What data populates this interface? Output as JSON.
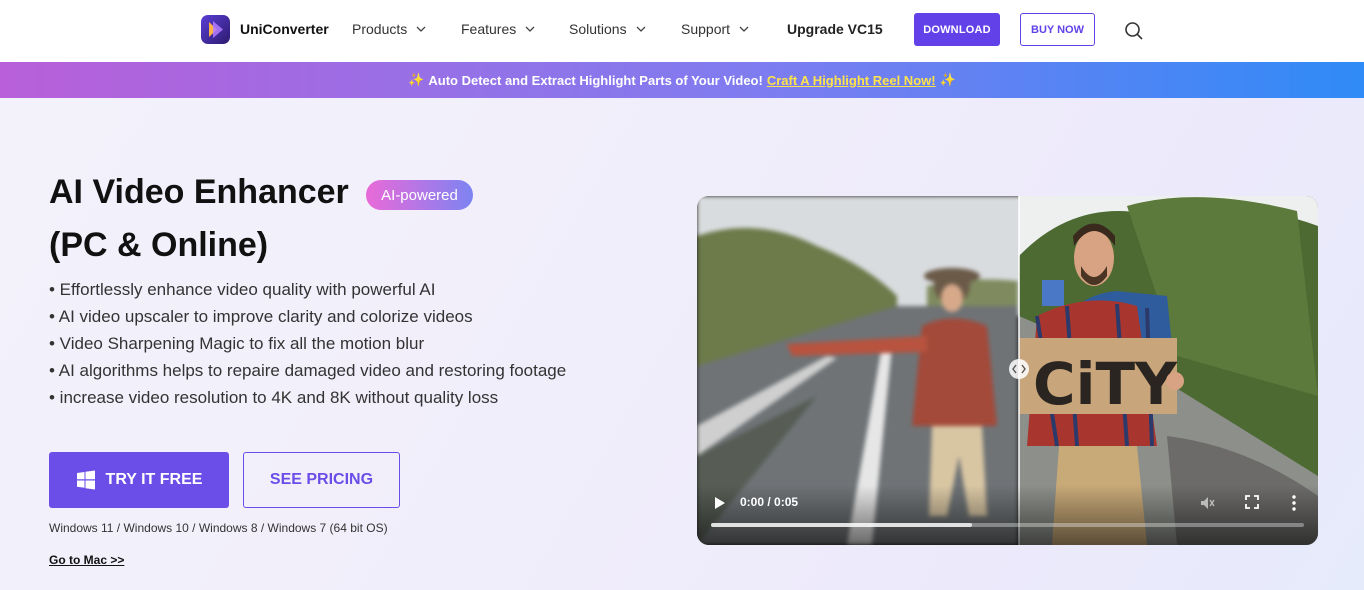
{
  "nav": {
    "brand": "UniConverter",
    "items": [
      {
        "label": "Products"
      },
      {
        "label": "Features"
      },
      {
        "label": "Solutions"
      },
      {
        "label": "Support"
      }
    ],
    "upgrade": "Upgrade VC15",
    "download": "DOWNLOAD",
    "buy": "BUY NOW",
    "search_icon": "search-icon"
  },
  "banner": {
    "text": "Auto Detect and Extract Highlight Parts of Your Video!",
    "link": "Craft A Highlight Reel Now!",
    "accent": "#ffe34a"
  },
  "hero": {
    "title_line1": "AI Video Enhancer",
    "badge": "AI-powered",
    "title_line2": "(PC & Online)",
    "features": [
      "• Effortlessly enhance video quality with powerful AI",
      "• AI video upscaler to improve clarity and colorize videos",
      "• Video Sharpening Magic to fix all the motion blur",
      "• AI algorithms helps to repaire damaged video and restoring footage",
      "• increase video resolution to 4K and 8K without quality loss"
    ],
    "try_free": "TRY IT FREE",
    "see_pricing": "SEE PRICING",
    "os_support": "Windows 11 / Windows 10 / Windows 8 / Windows 7 (64 bit OS)",
    "mac_link": "Go to Mac >>"
  },
  "video": {
    "time": "0:00 / 0:05",
    "sign_text": "CiTY",
    "progress_buffered": 0.44,
    "muted": true
  },
  "colors": {
    "primary": "#6242e8",
    "badge_start": "#e96ad8",
    "badge_end": "#7d83f2"
  }
}
